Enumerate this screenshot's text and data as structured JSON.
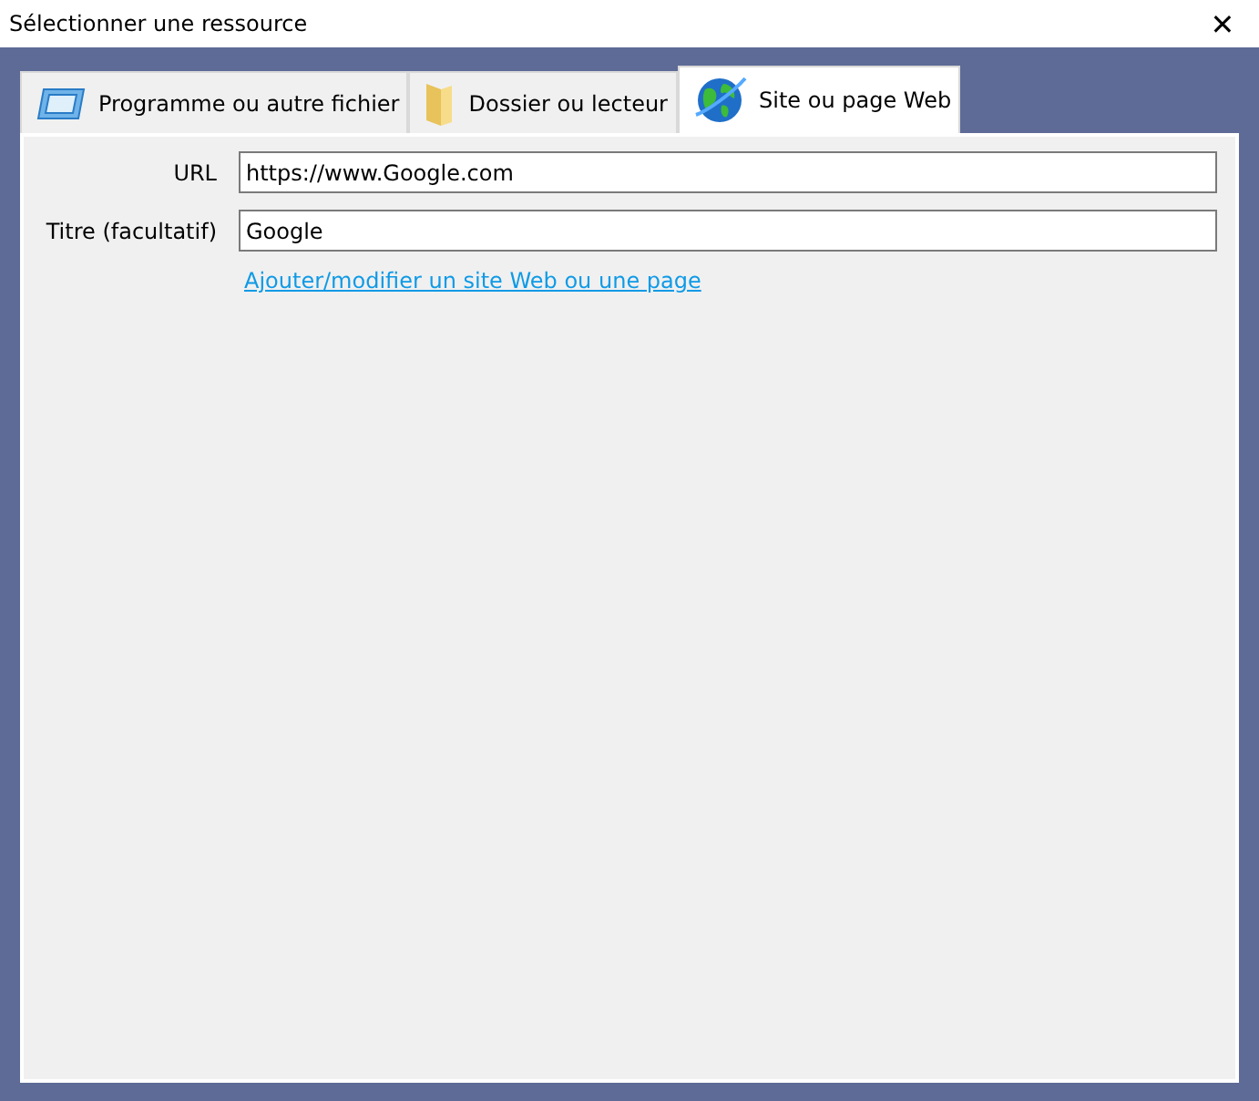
{
  "window": {
    "title": "Sélectionner une ressource",
    "close": "✕"
  },
  "tabs": [
    {
      "label": "Programme ou autre fichier",
      "kind": "program",
      "selected": false
    },
    {
      "label": "Dossier ou lecteur",
      "kind": "folder",
      "selected": false
    },
    {
      "label": "Site ou page Web",
      "kind": "globe",
      "selected": true
    }
  ],
  "fields": [
    {
      "label": "URL",
      "value": "https://www.Google.com"
    },
    {
      "label": "Titre (facultatif)",
      "value": "Google"
    }
  ],
  "link": "Ajouter/modifier un site Web ou une page"
}
